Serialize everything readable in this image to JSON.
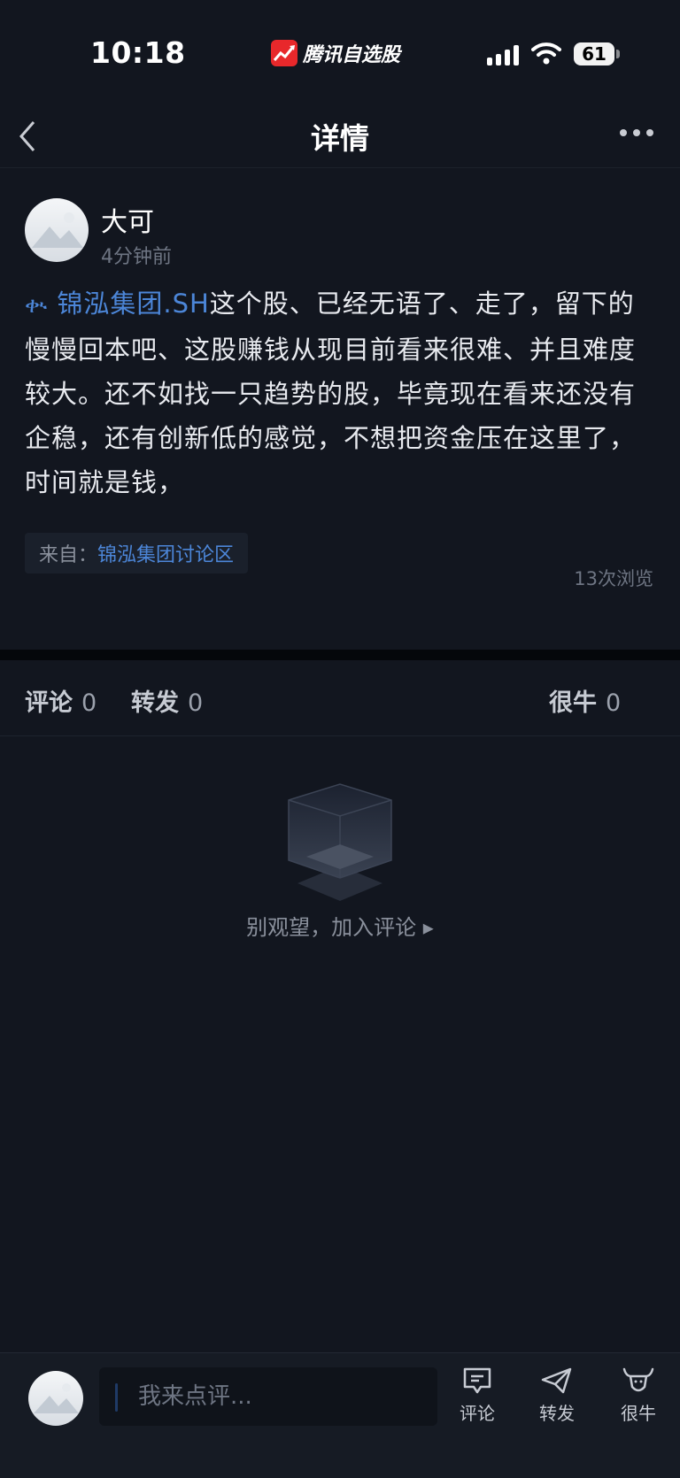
{
  "status_bar": {
    "time": "10:18",
    "app_name": "腾讯自选股",
    "battery": "61"
  },
  "nav": {
    "title": "详情"
  },
  "post": {
    "author": "大可",
    "time_ago": "4分钟前",
    "stock_link": "锦泓集团.SH",
    "body": "这个股、已经无语了、走了，留下的慢慢回本吧、这股赚钱从现目前看来很难、并且难度较大。还不如找一只趋势的股，毕竟现在看来还没有企稳，还有创新低的感觉，不想把资金压在这里了，时间就是钱，",
    "source_prefix": "来自：",
    "source_name": "锦泓集团讨论区",
    "views": "13次浏览"
  },
  "stats": {
    "comment_label": "评论",
    "comment_count": "0",
    "repost_label": "转发",
    "repost_count": "0",
    "like_label": "很牛",
    "like_count": "0"
  },
  "empty_state": {
    "text": "别观望，加入评论 ▸"
  },
  "bottom_bar": {
    "input_placeholder": "我来点评...",
    "comment_label": "评论",
    "repost_label": "转发",
    "like_label": "很牛"
  },
  "colors": {
    "background": "#12161f",
    "link": "#4c86d8",
    "logo_red": "#e8282b"
  }
}
